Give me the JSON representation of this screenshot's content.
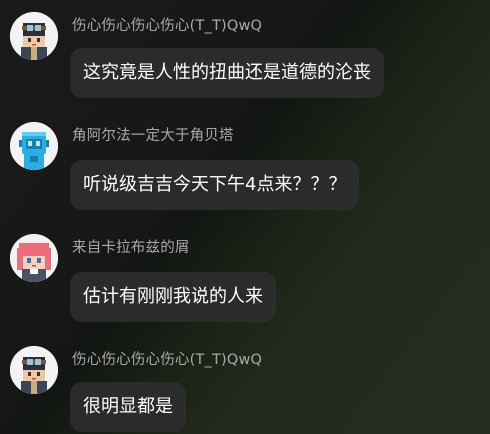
{
  "messages": [
    {
      "user": "伤心伤心伤心伤心(T_T)QwQ",
      "text": "这究竟是人性的扭曲还是道德的沦丧",
      "avatar_icon": "dark-hair-goggles-avatar-icon"
    },
    {
      "user": "角阿尔法一定大于角贝塔",
      "text": "听说级吉吉今天下午4点来？？？",
      "avatar_icon": "blue-robot-avatar-icon"
    },
    {
      "user": "来自卡拉布兹的屑",
      "text": "估计有刚刚我说的人来",
      "avatar_icon": "pink-hair-avatar-icon"
    },
    {
      "user": "伤心伤心伤心伤心(T_T)QwQ",
      "text": "很明显都是",
      "avatar_icon": "dark-hair-goggles-avatar-icon"
    }
  ],
  "colors": {
    "bubble": "#2c2c2c",
    "username": "#a9a9a9",
    "text": "#ffffff",
    "robot_avatar": "#29aee6",
    "pink_avatar": "#ee6d7a"
  }
}
